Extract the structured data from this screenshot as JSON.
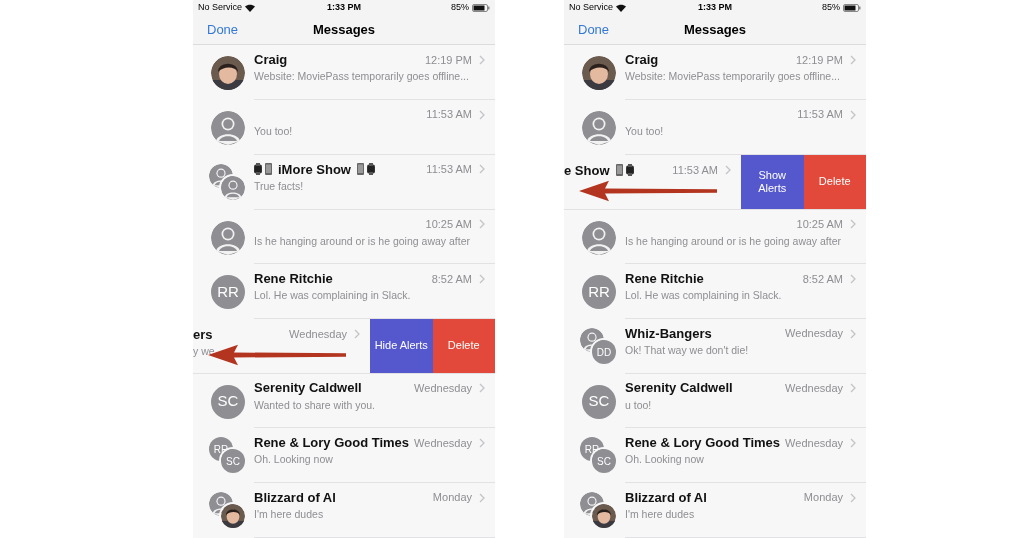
{
  "phones": [
    {
      "status_bar": {
        "carrier": "No Service",
        "time": "1:33 PM",
        "battery": "85%"
      },
      "nav": {
        "left_button": "Done",
        "title": "Messages"
      },
      "rows": [
        {
          "name": "Craig",
          "time": "12:19 PM",
          "preview": "Website: MoviePass temporarily goes offline..."
        },
        {
          "time": "11:53 AM",
          "preview": "You too!",
          "avatar": {
            "kind": "person"
          }
        },
        {
          "name": "iMore Show",
          "name_icons_before": true,
          "name_icons_after": true,
          "time": "11:53 AM",
          "preview": "True facts!",
          "avatar": {
            "kind": "pair",
            "back": {
              "kind": "person"
            },
            "front": {
              "kind": "person"
            }
          }
        },
        {
          "time": "10:25 AM",
          "preview": "Is he hanging around or is he going away after",
          "avatar": {
            "kind": "person"
          }
        },
        {
          "name": "Rene Ritchie",
          "time": "8:52 AM",
          "preview": "Lol. He was complaining in Slack.",
          "avatar": {
            "kind": "initials",
            "text": "RR"
          }
        },
        {
          "swiped": true,
          "name": "ers",
          "time": "Wednesday",
          "preview": "y we",
          "actions": [
            {
              "label": "Hide Alerts",
              "kind": "alerts"
            },
            {
              "label": "Delete",
              "kind": "delete"
            }
          ]
        },
        {
          "name": "Serenity Caldwell",
          "time": "Wednesday",
          "preview": "Wanted to share with you.",
          "avatar": {
            "kind": "initials",
            "text": "SC"
          }
        },
        {
          "name": "Rene & Lory Good Times",
          "time": "Wednesday",
          "preview": "Oh. Looking now",
          "avatar": {
            "kind": "pair",
            "back": {
              "kind": "initials",
              "text": "RR"
            },
            "front": {
              "kind": "initials",
              "text": "SC"
            }
          }
        },
        {
          "name": "Blizzard of Al",
          "time": "Monday",
          "preview": "I'm here dudes",
          "avatar": {
            "kind": "pair",
            "back": {
              "kind": "person"
            }
          }
        }
      ]
    },
    {
      "status_bar": {
        "carrier": "No Service",
        "time": "1:33 PM",
        "battery": "85%"
      },
      "nav": {
        "left_button": "Done",
        "title": "Messages"
      },
      "rows": [
        {
          "name": "Craig",
          "time": "12:19 PM",
          "preview": "Website: MoviePass temporarily goes offline..."
        },
        {
          "time": "11:53 AM",
          "preview": "You too!",
          "avatar": {
            "kind": "person"
          }
        },
        {
          "swiped": true,
          "name": "e Show",
          "name_icons_after": true,
          "time": "11:53 AM",
          "actions": [
            {
              "label": "Show Alerts",
              "kind": "alerts"
            },
            {
              "label": "Delete",
              "kind": "delete"
            }
          ]
        },
        {
          "time": "10:25 AM",
          "preview": "Is he hanging around or is he going away after",
          "avatar": {
            "kind": "person"
          }
        },
        {
          "name": "Rene Ritchie",
          "time": "8:52 AM",
          "preview": "Lol. He was complaining in Slack.",
          "avatar": {
            "kind": "initials",
            "text": "RR"
          }
        },
        {
          "name": "Whiz-Bangers",
          "time": "Wednesday",
          "preview": "Ok!  That way we don't die!",
          "avatar": {
            "kind": "pair",
            "back": {
              "kind": "person"
            },
            "front": {
              "kind": "initials",
              "text": "DD"
            }
          }
        },
        {
          "name": "Serenity Caldwell",
          "time": "Wednesday",
          "preview": "u too!",
          "avatar": {
            "kind": "initials",
            "text": "SC"
          }
        },
        {
          "name": "Rene & Lory Good Times",
          "time": "Wednesday",
          "preview": "Oh. Looking now",
          "avatar": {
            "kind": "pair",
            "back": {
              "kind": "initials",
              "text": "RR"
            },
            "front": {
              "kind": "initials",
              "text": "SC"
            }
          }
        },
        {
          "name": "Blizzard of Al",
          "time": "Monday",
          "preview": "I'm here dudes",
          "avatar": {
            "kind": "pair",
            "back": {
              "kind": "person"
            }
          }
        }
      ]
    }
  ]
}
